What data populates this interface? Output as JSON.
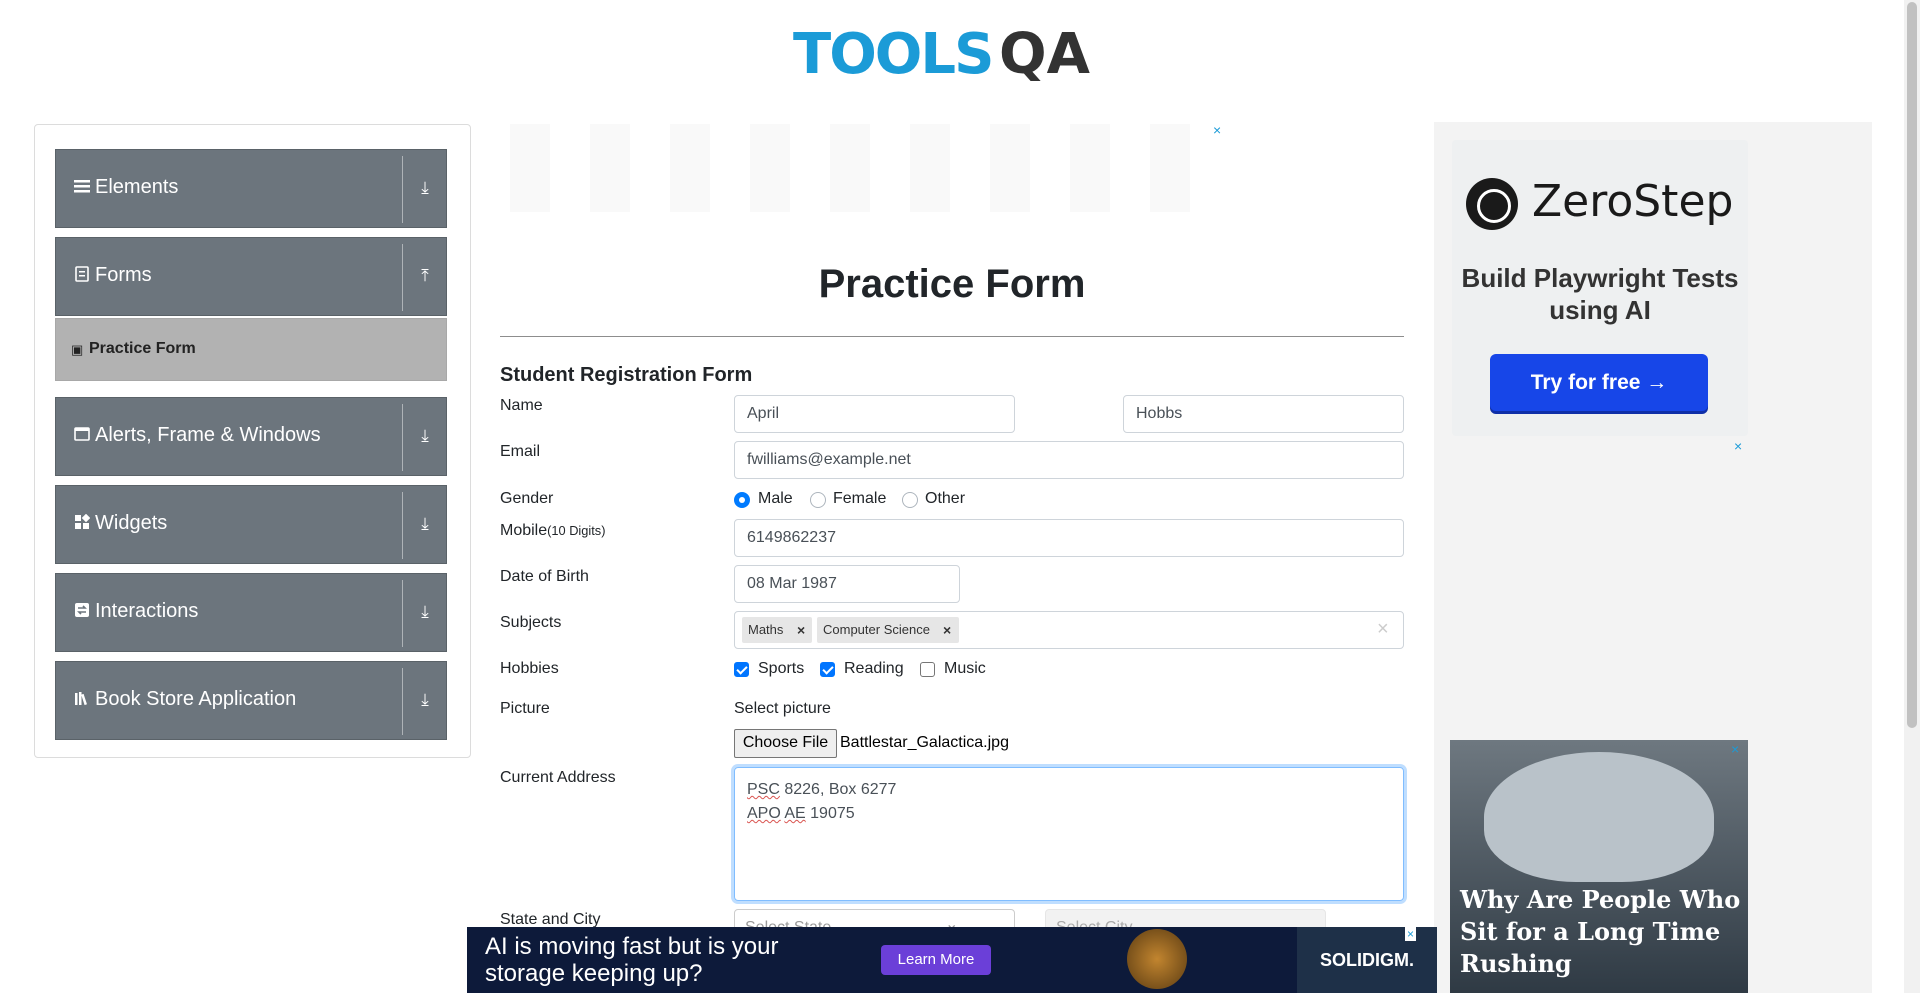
{
  "logo": {
    "text": "TOOLS",
    "suffix": "QA"
  },
  "sidebar": {
    "groups": [
      {
        "label": "Elements",
        "icon": "menu-icon",
        "arrow": "⤓"
      },
      {
        "label": "Forms",
        "icon": "form-icon",
        "arrow": "⤒"
      },
      {
        "label": "Alerts, Frame & Windows",
        "icon": "window-icon",
        "arrow": "⤓"
      },
      {
        "label": "Widgets",
        "icon": "widgets-icon",
        "arrow": "⤓"
      },
      {
        "label": "Interactions",
        "icon": "interactions-icon",
        "arrow": "⤓"
      },
      {
        "label": "Book Store Application",
        "icon": "book-icon",
        "arrow": "⤓"
      }
    ],
    "active_item": "Practice Form"
  },
  "main": {
    "page_title": "Practice Form",
    "form_title": "Student Registration Form",
    "labels": {
      "name": "Name",
      "email": "Email",
      "gender": "Gender",
      "mobile": "Mobile",
      "mobile_hint": "(10 Digits)",
      "dob": "Date of Birth",
      "subjects": "Subjects",
      "hobbies": "Hobbies",
      "picture": "Picture",
      "address": "Current Address",
      "state_city": "State and City"
    },
    "first_name": "April",
    "last_name": "Hobbs",
    "email": "fwilliams@example.net",
    "gender_options": [
      "Male",
      "Female",
      "Other"
    ],
    "gender_selected": "Male",
    "mobile": "6149862237",
    "dob": "08 Mar 1987",
    "subjects": [
      "Maths",
      "Computer Science"
    ],
    "hobbies": [
      {
        "label": "Sports",
        "checked": true
      },
      {
        "label": "Reading",
        "checked": true
      },
      {
        "label": "Music",
        "checked": false
      }
    ],
    "picture_label": "Select picture",
    "choose_file": "Choose File",
    "file_name": "Battlestar_Galactica.jpg",
    "address_line1_a": "PSC",
    "address_line1_b": " 8226, Box 6277",
    "address_line2_a": "APO",
    "address_line2_b": " ",
    "address_line2_c": "AE",
    "address_line2_d": " 19075",
    "state_placeholder": "Select State",
    "city_placeholder": "Select City"
  },
  "ads": {
    "close_glyph": "×",
    "zerostep_name": "ZeroStep",
    "zerostep_tag": "Build Playwright Tests using AI",
    "zerostep_cta": "Try for free →",
    "cushion_text": "Why Are People Who Sit for a Long Time Rushing",
    "bottom_text": "AI is moving fast but is your storage keeping up?",
    "bottom_cta": "Learn More",
    "bottom_brand": "SOLIDIGM."
  },
  "colors": {
    "sidebar_group": "#6c757d",
    "active_item": "#b2b2b2",
    "accent": "#007bff",
    "logo_blue": "#1b9bd7"
  }
}
